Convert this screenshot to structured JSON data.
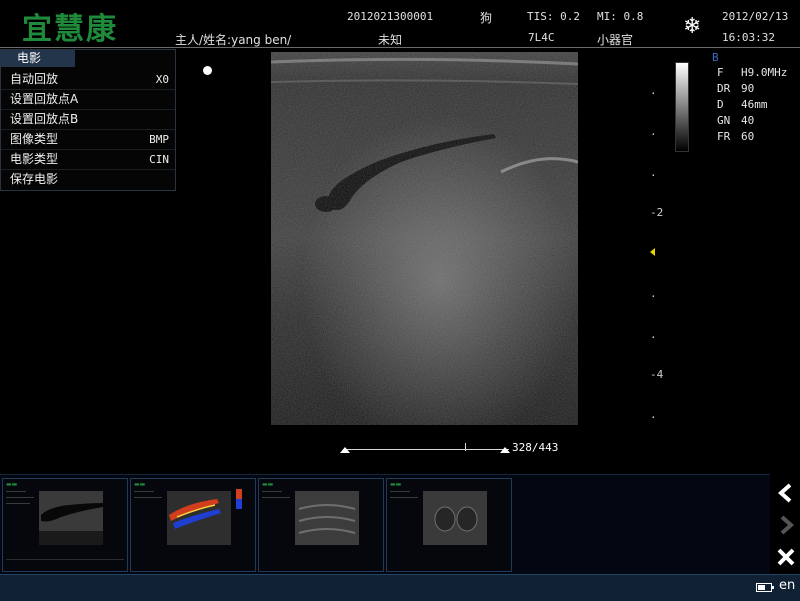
{
  "header": {
    "logo": "宜慧康",
    "patient_id": "2012021300001",
    "species": "狗",
    "owner_name_label": "主人/姓名:yang ben/",
    "unknown": "未知",
    "tis": "TIS: 0.2",
    "mi": "MI: 0.8",
    "probe": "7L4C",
    "preset": "小器官",
    "date": "2012/02/13",
    "time": "16:03:32",
    "freeze_icon": "snowflake-icon"
  },
  "cine_menu": {
    "title": "电影",
    "items": [
      {
        "label": "自动回放",
        "value": "X0"
      },
      {
        "label": "设置回放点A",
        "value": ""
      },
      {
        "label": "设置回放点B",
        "value": ""
      },
      {
        "label": "图像类型",
        "value": "BMP"
      },
      {
        "label": "电影类型",
        "value": "CIN"
      },
      {
        "label": "保存电影",
        "value": ""
      }
    ]
  },
  "depth_scale": {
    "labels": [
      "-2",
      "-4"
    ]
  },
  "params": {
    "mode": "B",
    "rows": [
      {
        "key": "F",
        "value": "H9.0MHz"
      },
      {
        "key": "DR",
        "value": "90"
      },
      {
        "key": "D",
        "value": "46mm"
      },
      {
        "key": "GN",
        "value": "40"
      },
      {
        "key": "FR",
        "value": "60"
      }
    ]
  },
  "cine_slider": {
    "frame_count": "328/443",
    "position": 0.735
  },
  "thumbnails": [
    {
      "kind": "b-mode"
    },
    {
      "kind": "color-doppler"
    },
    {
      "kind": "b-mode"
    },
    {
      "kind": "b-mode"
    }
  ],
  "nav": {
    "prev_icon": "chevron-left-icon",
    "next_icon": "chevron-right-icon",
    "close_icon": "close-icon"
  },
  "status_bar": {
    "language": "en",
    "battery_level": 0.6,
    "battery_icon": "battery-icon"
  },
  "colors": {
    "logo": "#1e8a3a",
    "menu_title_bg": "#23354a",
    "status_bar_bg": "#0f2133",
    "focus_marker": "#e6d300"
  }
}
